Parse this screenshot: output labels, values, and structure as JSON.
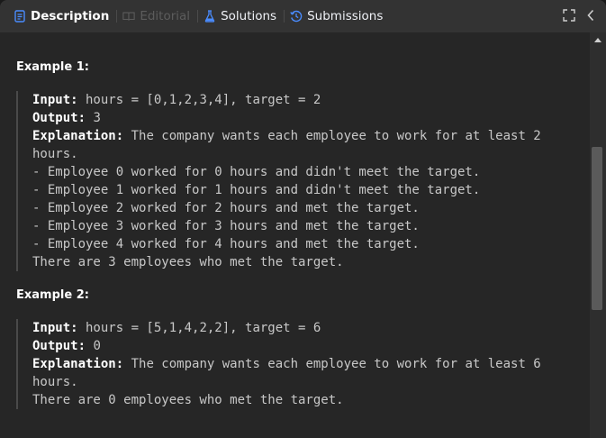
{
  "tabs": [
    {
      "label": "Description",
      "icon": "description-icon",
      "state": "active"
    },
    {
      "label": "Editorial",
      "icon": "book-icon",
      "state": "disabled"
    },
    {
      "label": "Solutions",
      "icon": "flask-icon",
      "state": "normal"
    },
    {
      "label": "Submissions",
      "icon": "history-icon",
      "state": "normal"
    }
  ],
  "colors": {
    "active_icon": "#4a8cff",
    "solutions_icon": "#4a8cff",
    "submissions_icon": "#4a8cff"
  },
  "examples": [
    {
      "title": "Example 1:",
      "input_label": "Input:",
      "input_value": " hours = [0,1,2,3,4], target = 2",
      "output_label": "Output:",
      "output_value": " 3",
      "explanation_label": "Explanation:",
      "explanation_value": " The company wants each employee to work for at least 2",
      "explanation_lines": [
        "hours.",
        "- Employee 0 worked for 0 hours and didn't meet the target.",
        "- Employee 1 worked for 1 hours and didn't meet the target.",
        "- Employee 2 worked for 2 hours and met the target.",
        "- Employee 3 worked for 3 hours and met the target.",
        "- Employee 4 worked for 4 hours and met the target.",
        "There are 3 employees who met the target."
      ]
    },
    {
      "title": "Example 2:",
      "input_label": "Input:",
      "input_value": " hours = [5,1,4,2,2], target = 6",
      "output_label": "Output:",
      "output_value": " 0",
      "explanation_label": "Explanation:",
      "explanation_value": " The company wants each employee to work for at least 6",
      "explanation_lines": [
        "hours.",
        "There are 0 employees who met the target."
      ]
    }
  ]
}
